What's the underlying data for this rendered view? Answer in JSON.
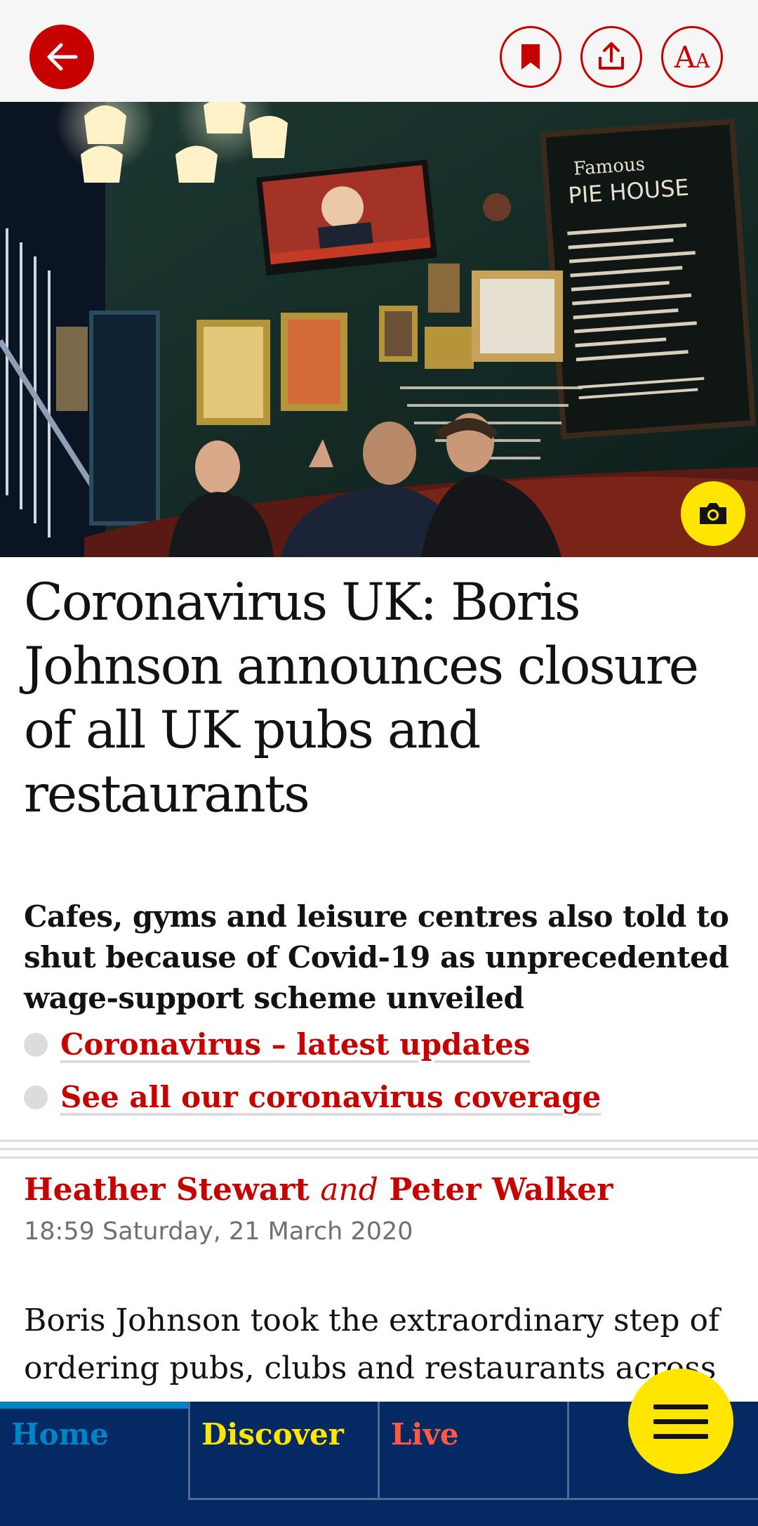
{
  "toolbar": {
    "back_icon": "arrow-left-icon",
    "bookmark_icon": "bookmark-icon",
    "share_icon": "share-icon",
    "text_size_icon": "text-size-icon",
    "text_size_big": "A",
    "text_size_small": "A"
  },
  "hero": {
    "image_description": "Men sitting in a London pub under a TV",
    "camera_icon": "camera-icon"
  },
  "article": {
    "headline": "Coronavirus UK: Boris Johnson announces closure of all UK pubs and restaurants",
    "standfirst": "Cafes, gyms and leisure centres also told to shut because of Covid-19 as unprecedented wage-support scheme unveiled",
    "links": [
      "Coronavirus – latest updates",
      "See all our coronavirus coverage"
    ],
    "author1": "Heather Stewart",
    "and": "and",
    "author2": "Peter Walker",
    "dateline": "18:59 Saturday, 21 March 2020",
    "body": "Boris Johnson took the extraordinary step of ordering pubs, clubs and restaurants across"
  },
  "nav": {
    "tabs": [
      "Home",
      "Discover",
      "Live"
    ],
    "menu_icon": "hamburger-menu-icon"
  },
  "colors": {
    "accent_red": "#c70000",
    "nav_blue": "#052962",
    "home_blue": "#0084c6",
    "discover_yellow": "#ffe500",
    "live_red": "#ff5943"
  }
}
